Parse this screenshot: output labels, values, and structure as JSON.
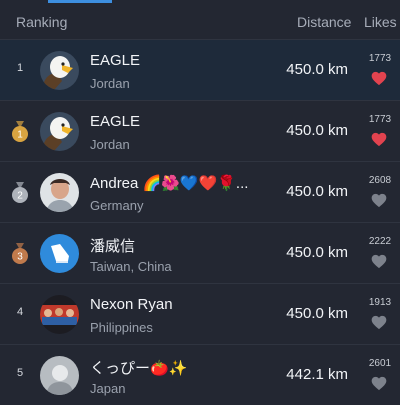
{
  "header": {
    "ranking": "Ranking",
    "distance": "Distance",
    "likes": "Likes"
  },
  "rows": [
    {
      "rank": "1",
      "medal": "",
      "name": "EAGLE",
      "country": "Jordan",
      "distance": "450.0 km",
      "likes": "1773",
      "liked": true,
      "avatar": "eagle",
      "highlight": true
    },
    {
      "rank": "",
      "medal": "gold",
      "name": "EAGLE",
      "country": "Jordan",
      "distance": "450.0 km",
      "likes": "1773",
      "liked": true,
      "avatar": "eagle",
      "highlight": false
    },
    {
      "rank": "",
      "medal": "silver",
      "name": "Andrea 🌈🌺💙❤️🌹...",
      "country": "Germany",
      "distance": "450.0 km",
      "likes": "2608",
      "liked": false,
      "avatar": "photo",
      "highlight": false
    },
    {
      "rank": "",
      "medal": "bronze",
      "name": "潘威信",
      "country": "Taiwan, China",
      "distance": "450.0 km",
      "likes": "2222",
      "liked": false,
      "avatar": "shoe",
      "highlight": false
    },
    {
      "rank": "4",
      "medal": "",
      "name": "Nexon Ryan",
      "country": "Philippines",
      "distance": "450.0 km",
      "likes": "1913",
      "liked": false,
      "avatar": "group",
      "highlight": false
    },
    {
      "rank": "5",
      "medal": "",
      "name": "くっぴー🍅✨",
      "country": "Japan",
      "distance": "442.1 km",
      "likes": "2601",
      "liked": false,
      "avatar": "gray",
      "highlight": false
    }
  ],
  "colors": {
    "liked": "#e2434f",
    "unliked": "#7d828c",
    "gold": "#d9a441",
    "silver": "#aeb3bb",
    "bronze": "#c07a4c",
    "accent": "#3d8fe0"
  }
}
